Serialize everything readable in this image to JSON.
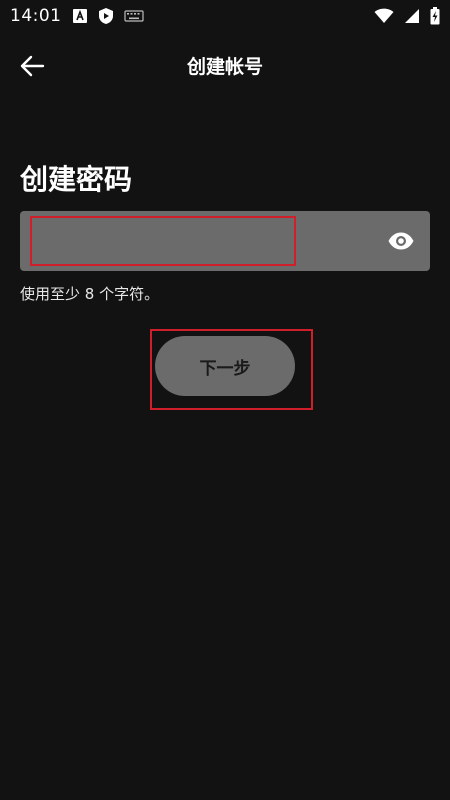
{
  "status_bar": {
    "time": "14:01",
    "icons": [
      "font-a-icon",
      "shield-play-icon",
      "keyboard-icon",
      "wifi-icon",
      "signal-icon",
      "battery-charging-icon"
    ]
  },
  "app_bar": {
    "title": "创建帐号",
    "back_icon": "arrow-left-icon"
  },
  "page": {
    "heading": "创建密码",
    "password_field": {
      "value": "",
      "placeholder": "",
      "toggle_icon": "eye-icon"
    },
    "helper_text": "使用至少 8 个字符。",
    "next_button_label": "下一步"
  },
  "colors": {
    "background": "#121212",
    "field_bg": "#6b6b6b",
    "highlight": "#d01f2a",
    "text": "#ffffff"
  }
}
